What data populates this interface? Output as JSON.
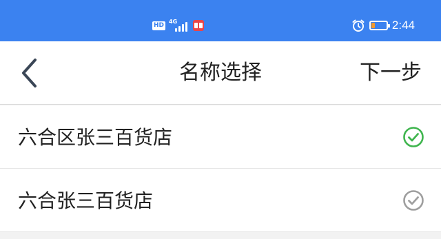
{
  "status_bar": {
    "hd_label": "HD",
    "network_label": "4G",
    "time": "2:44",
    "battery_level": 0.25,
    "colors": {
      "background": "#3b82f0",
      "battery": "#f29a2e",
      "notification": "#e8454a"
    },
    "icons": [
      "signal-icon",
      "notification-icon",
      "alarm-icon",
      "battery-icon"
    ]
  },
  "nav": {
    "title": "名称选择",
    "next_label": "下一步",
    "back_icon": "chevron-left-icon"
  },
  "options": [
    {
      "label": "六合区张三百货店",
      "selected": true,
      "check_color": "#3fb54e"
    },
    {
      "label": "六合张三百货店",
      "selected": false,
      "check_color": "#9e9e9e"
    }
  ]
}
